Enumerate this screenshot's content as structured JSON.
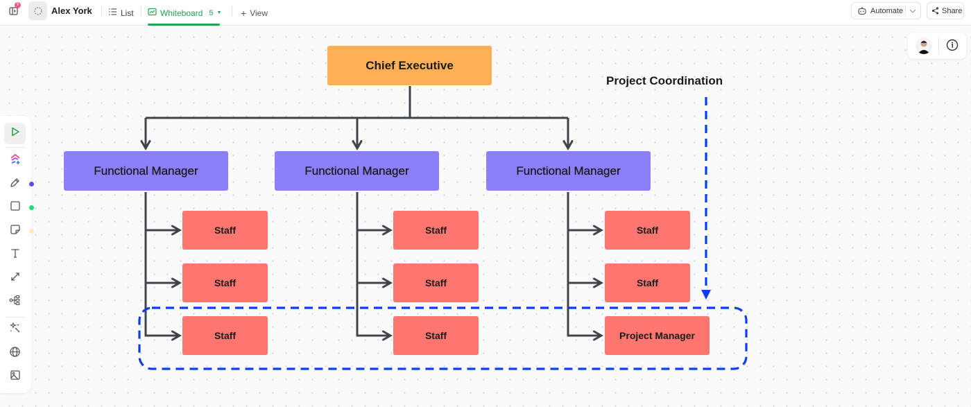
{
  "header": {
    "notification_count": "9",
    "title": "Alex York",
    "tabs": [
      {
        "label": "List",
        "icon": "list-icon"
      },
      {
        "label": "Whiteboard",
        "count": "5",
        "icon": "whiteboard-icon",
        "active": true
      }
    ],
    "add_view_label": "View",
    "automate_label": "Automate",
    "share_label": "Share"
  },
  "toolbar": {
    "tools": [
      "select-icon",
      "ai-brain-icon",
      "pen-icon",
      "rectangle-icon",
      "sticky-note-icon",
      "text-icon",
      "connector-icon",
      "mindmap-icon",
      "magic-wand-icon",
      "globe-icon",
      "image-icon"
    ],
    "dot_colors": {
      "pen": "#5b4fe0",
      "shape": "#2ed573",
      "sticky": "#fde8b8"
    }
  },
  "colors": {
    "accent": "#22a34a",
    "executive": "#ffb056",
    "functional_manager": "#8b80f9",
    "staff": "#ff7570",
    "connector": "#3f434a",
    "dashed_highlight": "#0b3df5"
  },
  "org_chart": {
    "executive": "Chief Executive",
    "annotation": "Project Coordination",
    "managers": [
      {
        "label": "Functional Manager",
        "reports": [
          "Staff",
          "Staff",
          "Staff"
        ]
      },
      {
        "label": "Functional Manager",
        "reports": [
          "Staff",
          "Staff",
          "Staff"
        ]
      },
      {
        "label": "Functional Manager",
        "reports": [
          "Staff",
          "Staff",
          "Project Manager"
        ]
      }
    ]
  }
}
